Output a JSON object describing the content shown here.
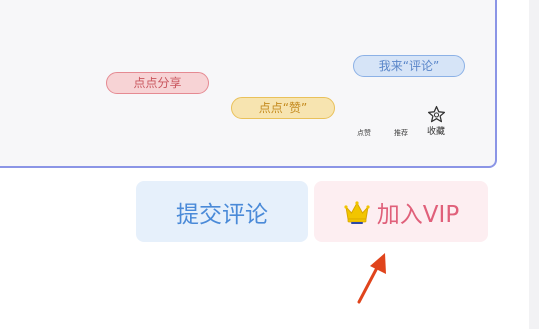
{
  "editor": {
    "tags": {
      "share": "点点分享",
      "like": "点点“赞”",
      "comment": "我来“评论”"
    },
    "actions": {
      "like": "点赞",
      "recommend": "推荐",
      "favorite": "收藏"
    }
  },
  "buttons": {
    "submit": "提交评论",
    "vip": "加入VIP"
  },
  "colors": {
    "panel_border": "#8b95e6",
    "submit_text": "#4a8ad8",
    "vip_text": "#e0607a",
    "arrow": "#e0441c",
    "crown": "#f2c500"
  },
  "icons": {
    "favorite": "star-icon",
    "vip": "crown-icon",
    "pointer": "red-arrow-icon"
  }
}
